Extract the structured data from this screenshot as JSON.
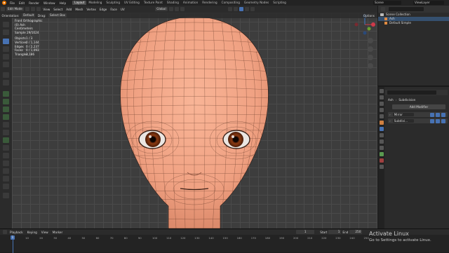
{
  "menu": {
    "file": "File",
    "edit": "Edit",
    "render": "Render",
    "window": "Window",
    "help": "Help"
  },
  "workspaces": [
    "Layout",
    "Modeling",
    "Sculpting",
    "UV Editing",
    "Texture Paint",
    "Shading",
    "Animation",
    "Rendering",
    "Compositing",
    "Geometry Nodes",
    "Scripting"
  ],
  "scene": {
    "label": "Scene",
    "view_layer": "ViewLayer"
  },
  "header": {
    "orientation_label": "Orientation:",
    "orientation_value": "Default",
    "drag_label": "Drag:",
    "drag_value": "Select Box",
    "mode": "Edit Mode",
    "view": "View",
    "select": "Select",
    "add": "Add",
    "mesh": "Mesh",
    "vertex": "Vertex",
    "edge": "Edge",
    "face": "Face",
    "uv": "UV",
    "transform": "Global",
    "options": "Options"
  },
  "overlay": {
    "view": "Front Orthographic",
    "object": "(0) Ash",
    "units": "Centimeters",
    "sample": "Sample 29/1024",
    "stats": [
      {
        "k": "Objects",
        "v": "1 / 3"
      },
      {
        "k": "Vertices",
        "v": "0 / 1,144"
      },
      {
        "k": "Edges",
        "v": "0 / 2,237"
      },
      {
        "k": "Faces",
        "v": "0 / 1,093"
      },
      {
        "k": "Triangles",
        "v": "2,186"
      }
    ]
  },
  "outliner": {
    "scene_collection": "Scene Collection",
    "items": [
      "Ash",
      "Default Simple"
    ]
  },
  "properties": {
    "object": "Ash",
    "modifier_type": "Subdivision",
    "add_modifier": "Add Modifier",
    "modifiers": [
      "Mirror",
      "Subdivi..."
    ]
  },
  "timeline": {
    "playback": "Playback",
    "keying": "Keying",
    "view": "View",
    "marker": "Marker",
    "current_frame": "1",
    "start_label": "Start",
    "start": "1",
    "end_label": "End",
    "end": "250",
    "ticks": [
      "0",
      "10",
      "20",
      "30",
      "40",
      "50",
      "60",
      "70",
      "80",
      "90",
      "100",
      "110",
      "120",
      "130",
      "140",
      "150",
      "160",
      "170",
      "180",
      "190",
      "200",
      "210",
      "220",
      "230",
      "240",
      "250"
    ]
  },
  "watermark": {
    "title": "Activate Linux",
    "subtitle": "Go to Settings to activate Linux."
  },
  "colors": {
    "accent": "#4772b3",
    "skin": "#f3a989",
    "iris": "#8a3a12",
    "selected_row": "#35506f"
  }
}
